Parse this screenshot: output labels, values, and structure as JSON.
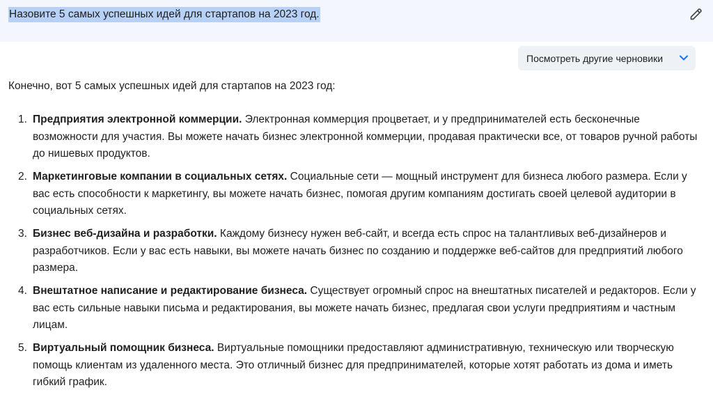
{
  "prompt": {
    "text": "Назовите 5 самых успешных идей для стартапов на 2023 год."
  },
  "icons": {
    "edit": "pencil-icon",
    "drafts_toggle": "chevron-down-icon"
  },
  "colors": {
    "prompt_bg": "#f3f6fc",
    "selection": "#b7d0f5",
    "drafts_bg": "#eef1f6",
    "chevron": "#1a73e8"
  },
  "drafts_button": {
    "label": "Посмотреть другие черновики"
  },
  "answer": {
    "intro": "Конечно, вот 5 самых успешных идей для стартапов на 2023 год:",
    "items": [
      {
        "number": "1.",
        "title": "Предприятия электронной коммерции.",
        "text": " Электронная коммерция процветает, и у предпринимателей есть бесконечные возможности для участия. Вы можете начать бизнес электронной коммерции, продавая практически все, от товаров ручной работы до нишевых продуктов."
      },
      {
        "number": "2.",
        "title": "Маркетинговые компании в социальных сетях.",
        "text": " Социальные сети — мощный инструмент для бизнеса любого размера. Если у вас есть способности к маркетингу, вы можете начать бизнес, помогая другим компаниям достигать своей целевой аудитории в социальных сетях."
      },
      {
        "number": "3.",
        "title": "Бизнес веб-дизайна и разработки.",
        "text": " Каждому бизнесу нужен веб-сайт, и всегда есть спрос на талантливых веб-дизайнеров и разработчиков. Если у вас есть навыки, вы можете начать бизнес по созданию и поддержке веб-сайтов для предприятий любого размера."
      },
      {
        "number": "4.",
        "title": "Внештатное написание и редактирование бизнеса.",
        "text": " Существует огромный спрос на внештатных писателей и редакторов. Если у вас есть сильные навыки письма и редактирования, вы можете начать бизнес, предлагая свои услуги предприятиям и частным лицам."
      },
      {
        "number": "5.",
        "title": "Виртуальный помощник бизнеса.",
        "text": " Виртуальные помощники предоставляют административную, техническую или творческую помощь клиентам из удаленного места. Это отличный бизнес для предпринимателей, которые хотят работать из дома и иметь гибкий график."
      }
    ]
  }
}
